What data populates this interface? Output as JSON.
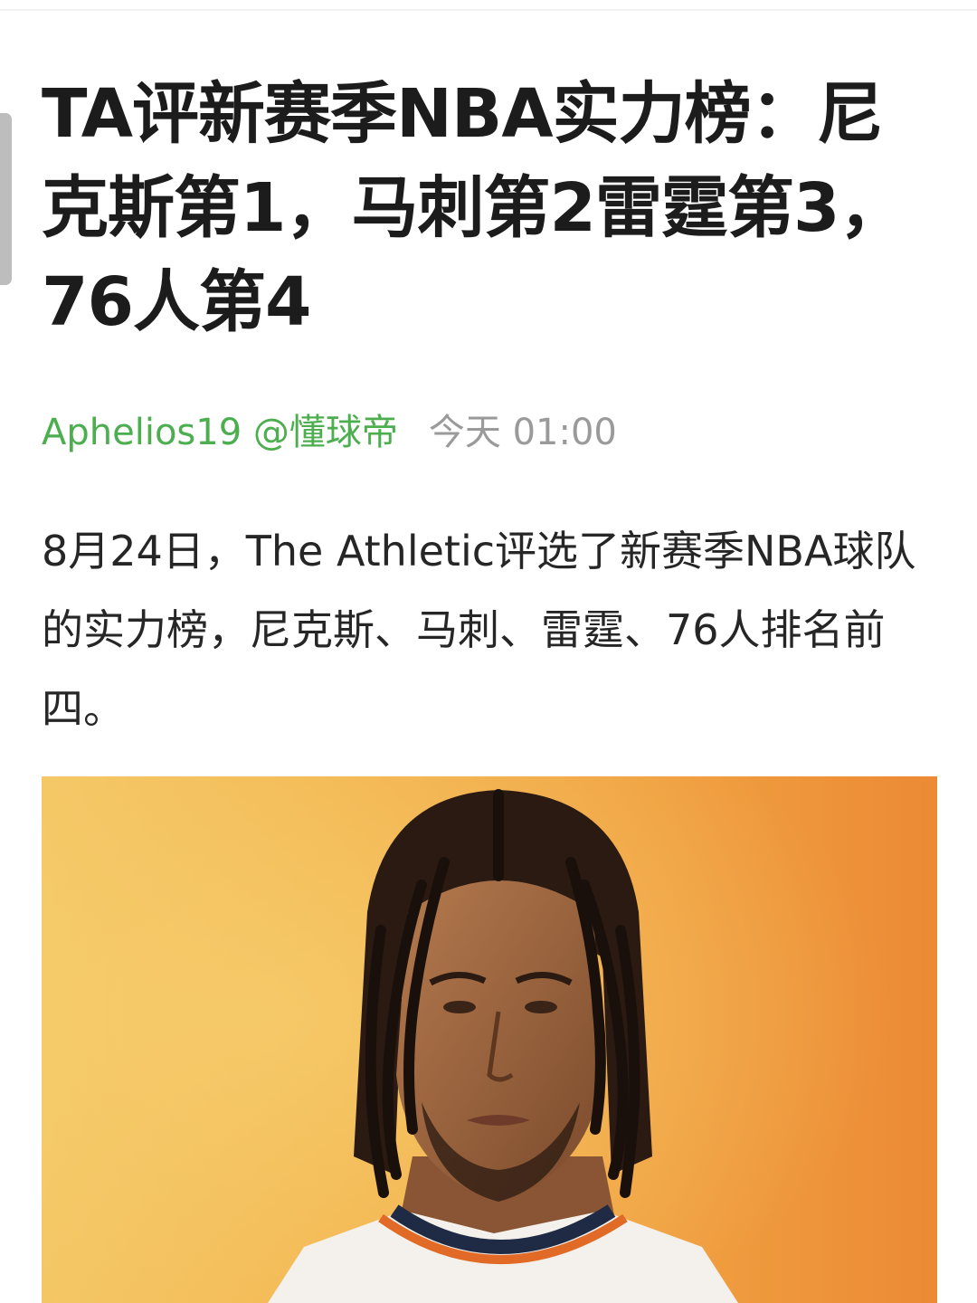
{
  "article": {
    "title": "TA评新赛季NBA实力榜：尼克斯第1，马刺第2雷霆第3，76人第4",
    "author": "Aphelios19 @懂球帝",
    "time": "今天 01:00",
    "body": "8月24日，The Athletic评选了新赛季NBA球队的实力榜，尼克斯、马刺、雷霆、76人排名前四。"
  }
}
